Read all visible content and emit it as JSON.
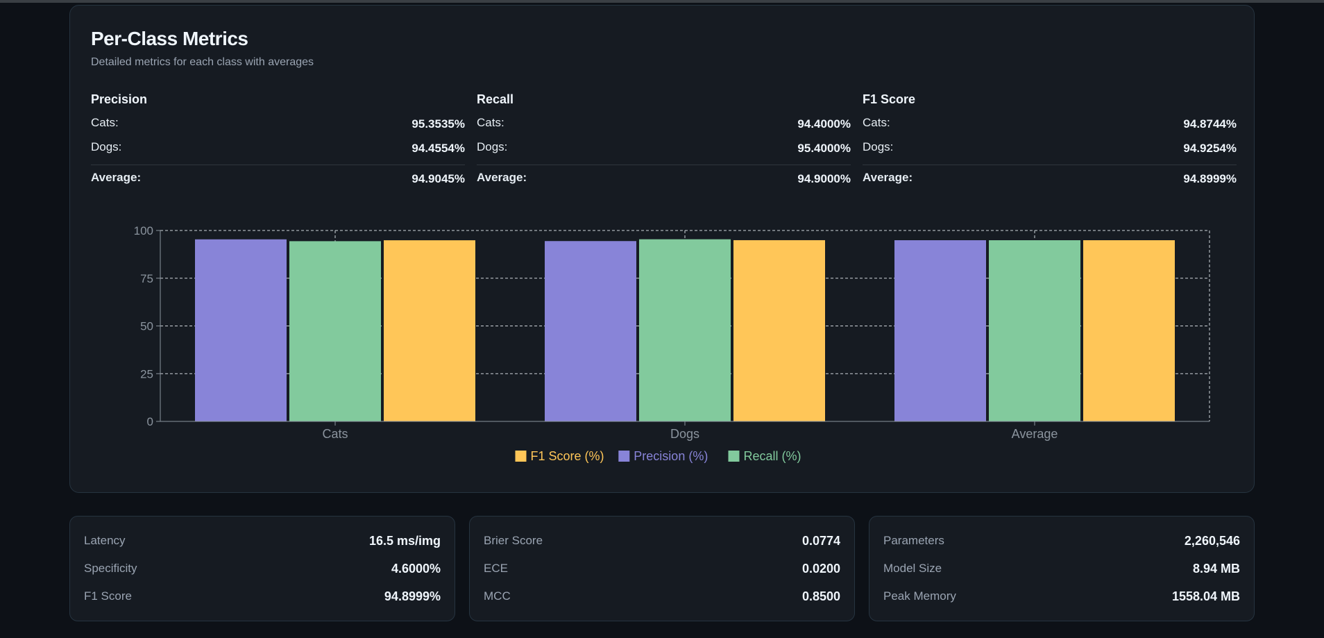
{
  "card": {
    "title": "Per-Class Metrics",
    "subtitle": "Detailed metrics for each class with averages"
  },
  "metrics": [
    {
      "header": "Precision",
      "rows": [
        {
          "label": "Cats:",
          "value": "95.3535%"
        },
        {
          "label": "Dogs:",
          "value": "94.4554%"
        }
      ],
      "average": {
        "label": "Average:",
        "value": "94.9045%"
      }
    },
    {
      "header": "Recall",
      "rows": [
        {
          "label": "Cats:",
          "value": "94.4000%"
        },
        {
          "label": "Dogs:",
          "value": "95.4000%"
        }
      ],
      "average": {
        "label": "Average:",
        "value": "94.9000%"
      }
    },
    {
      "header": "F1 Score",
      "rows": [
        {
          "label": "Cats:",
          "value": "94.8744%"
        },
        {
          "label": "Dogs:",
          "value": "94.9254%"
        }
      ],
      "average": {
        "label": "Average:",
        "value": "94.8999%"
      }
    }
  ],
  "chart_data": {
    "type": "bar",
    "categories": [
      "Cats",
      "Dogs",
      "Average"
    ],
    "series": [
      {
        "name": "Precision (%)",
        "color": "#8884d8",
        "values": [
          95.3535,
          94.4554,
          94.9045
        ]
      },
      {
        "name": "Recall (%)",
        "color": "#82ca9d",
        "values": [
          94.4,
          95.4,
          94.9
        ]
      },
      {
        "name": "F1 Score (%)",
        "color": "#ffc658",
        "values": [
          94.8744,
          94.9254,
          94.8999
        ]
      }
    ],
    "legend_order": [
      "F1 Score (%)",
      "Precision (%)",
      "Recall (%)"
    ],
    "ylim": [
      0,
      100
    ],
    "yticks": [
      0,
      25,
      50,
      75,
      100
    ],
    "grid": true,
    "legend_position": "bottom-center"
  },
  "panels": [
    {
      "rows": [
        {
          "label": "Latency",
          "value": "16.5 ms/img"
        },
        {
          "label": "Specificity",
          "value": "4.6000%"
        },
        {
          "label": "F1 Score",
          "value": "94.8999%"
        }
      ]
    },
    {
      "rows": [
        {
          "label": "Brier Score",
          "value": "0.0774"
        },
        {
          "label": "ECE",
          "value": "0.0200"
        },
        {
          "label": "MCC",
          "value": "0.8500"
        }
      ]
    },
    {
      "rows": [
        {
          "label": "Parameters",
          "value": "2,260,546"
        },
        {
          "label": "Model Size",
          "value": "8.94 MB"
        },
        {
          "label": "Peak Memory",
          "value": "1558.04 MB"
        }
      ]
    }
  ]
}
